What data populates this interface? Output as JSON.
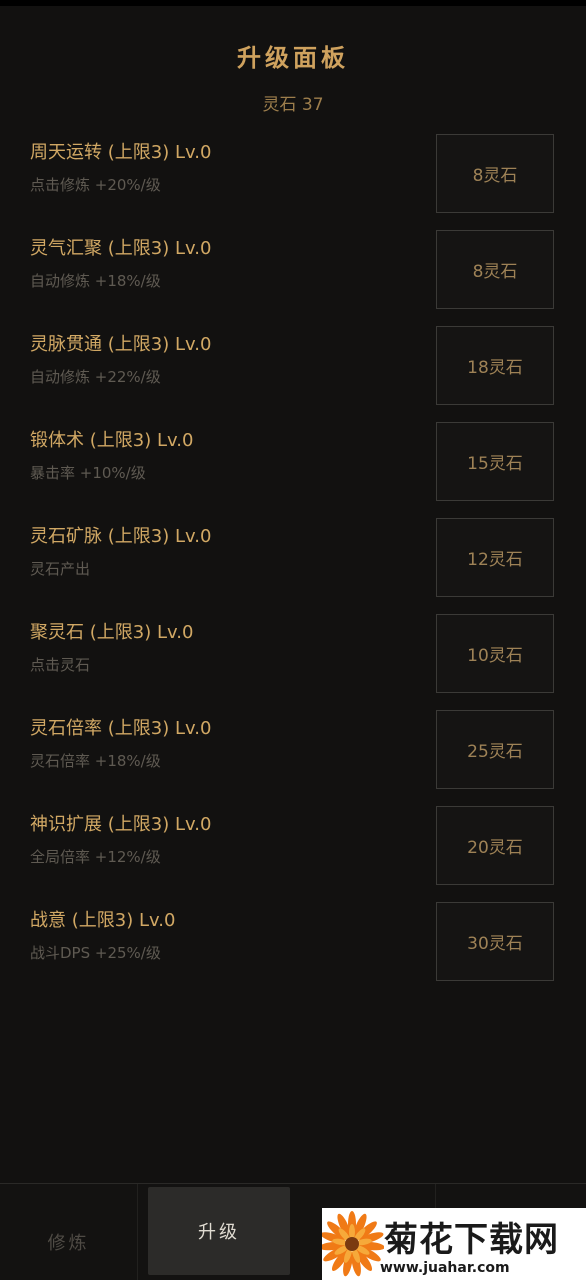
{
  "header": {
    "title": "升级面板",
    "stones": "灵石 37"
  },
  "upgrades": [
    {
      "name": "周天运转 (上限3) Lv.0",
      "desc": "点击修炼 +20%/级",
      "cost": "8灵石"
    },
    {
      "name": "灵气汇聚 (上限3) Lv.0",
      "desc": "自动修炼 +18%/级",
      "cost": "8灵石"
    },
    {
      "name": "灵脉贯通 (上限3) Lv.0",
      "desc": "自动修炼 +22%/级",
      "cost": "18灵石"
    },
    {
      "name": "锻体术 (上限3) Lv.0",
      "desc": "暴击率 +10%/级",
      "cost": "15灵石"
    },
    {
      "name": "灵石矿脉 (上限3) Lv.0",
      "desc": "灵石产出",
      "cost": "12灵石"
    },
    {
      "name": "聚灵石 (上限3) Lv.0",
      "desc": "点击灵石",
      "cost": "10灵石"
    },
    {
      "name": "灵石倍率 (上限3) Lv.0",
      "desc": "灵石倍率 +18%/级",
      "cost": "25灵石"
    },
    {
      "name": "神识扩展 (上限3) Lv.0",
      "desc": "全局倍率 +12%/级",
      "cost": "20灵石"
    },
    {
      "name": "战意 (上限3) Lv.0",
      "desc": "战斗DPS +25%/级",
      "cost": "30灵石"
    }
  ],
  "nav": {
    "tabs": [
      {
        "label": "修炼",
        "active": false
      },
      {
        "label": "升级",
        "active": true
      }
    ]
  },
  "watermark": {
    "title": "菊花下载网",
    "url": "www.juahar.com"
  },
  "colors": {
    "background": "#121110",
    "accent_gold": "#d1a864",
    "muted_text": "#5f5a52",
    "active_tab": "#2c2b29"
  }
}
